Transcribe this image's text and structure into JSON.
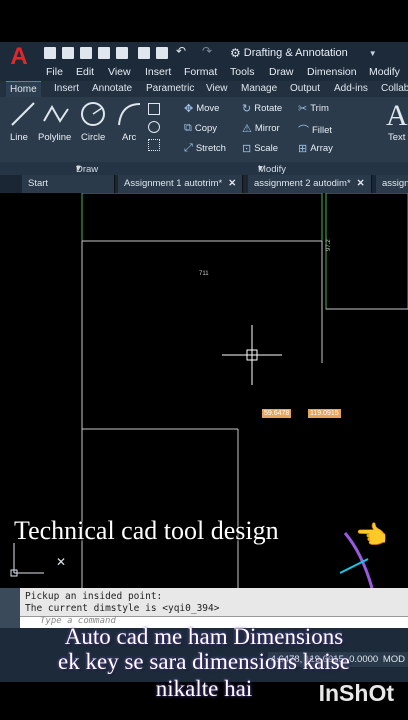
{
  "app": {
    "logo": "A",
    "workspace": "Drafting & Annotation"
  },
  "menu": [
    "File",
    "Edit",
    "View",
    "Insert",
    "Format",
    "Tools",
    "Draw",
    "Dimension",
    "Modify"
  ],
  "ribbon_tabs": [
    "Home",
    "Insert",
    "Annotate",
    "Parametric",
    "View",
    "Manage",
    "Output",
    "Add-ins",
    "Collab"
  ],
  "draw_tools": [
    "Line",
    "Polyline",
    "Circle",
    "Arc"
  ],
  "modify_tools": {
    "row1": [
      "Move",
      "Rotate",
      "Trim"
    ],
    "row2": [
      "Copy",
      "Mirror",
      "Fillet"
    ],
    "row3": [
      "Stretch",
      "Scale",
      "Array"
    ]
  },
  "text_tool": "Text",
  "panels": {
    "draw": "Draw",
    "modify": "Modify"
  },
  "file_tabs": [
    "Start",
    "Assignment 1 autotrim*",
    "assignment 2 autodim*",
    "assign"
  ],
  "canvas": {
    "dim_label": "711",
    "dim_vertical": "97.2",
    "cursor_input1": "59.6478",
    "cursor_input2": "119.0915"
  },
  "command": {
    "line1": "Pickup an insided point:",
    "line2": "The current dimstyle is <yqi0_394>",
    "placeholder": "Type a command"
  },
  "status": {
    "coords": "4.6478, 119.0915, 0.0000",
    "mode": "MOD"
  },
  "captions": {
    "top": "Technical cad tool design",
    "bottom1": "Auto cad me ham Dimensions",
    "bottom2": "ek key se sara dimensions kaise",
    "bottom3": "nikalte hai"
  },
  "watermark": "InShOt"
}
